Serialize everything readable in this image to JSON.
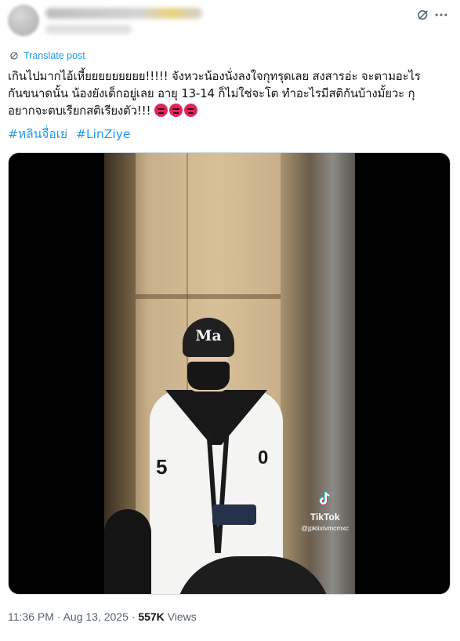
{
  "header": {
    "grok_icon": "grok-icon",
    "more_icon": "more-options-icon"
  },
  "translate": {
    "label": "Translate post",
    "icon": "translate-icon",
    "color": "#1d9bf0"
  },
  "post": {
    "text": "เกินไปมากไอ้เหี้ยยยยยยยยย!!!!! จังหวะน้องนั่งลงใจกุทรุดเลย สงสารอ่ะ จะตามอะไร\nกันขนาดนั้น น้องยังเด็กอยู่เลย อายุ 13-14 ก็ไม่ใช่จะโต ทำอะไรมีสติกันบ้างมั้ยวะ กุ\nอยากจะตบเรียกสติเรียงตัว!!!",
    "emoji": [
      "angry-face-emoji",
      "angry-face-emoji",
      "angry-face-emoji"
    ],
    "hashtags": [
      "#หลินจื่อเย่",
      "#LinZiye"
    ]
  },
  "media": {
    "beanie_text": "Ma",
    "shirt_number_left": "5",
    "shirt_number_right": "0",
    "watermark_brand": "TikTok",
    "watermark_user": "@jpkiixivmcmxc"
  },
  "meta": {
    "time": "11:36 PM",
    "separator": "·",
    "date": "Aug 13, 2025",
    "views_count": "557K",
    "views_label": "Views"
  }
}
